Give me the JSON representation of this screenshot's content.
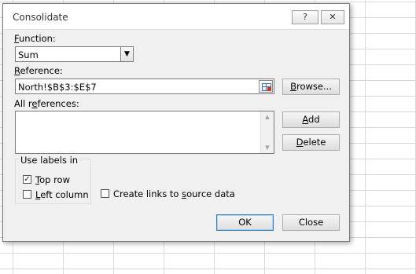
{
  "dialog": {
    "title": "Consolidate",
    "help_button": "?",
    "close_glyph": "✕",
    "help_icon": "question-icon",
    "close_icon": "close-icon"
  },
  "function": {
    "label_accel": "F",
    "label_rest": "unction:",
    "selected_value": "Sum",
    "dropdown_glyph": "▼"
  },
  "reference": {
    "label_accel": "R",
    "label_rest": "eference:",
    "value": "North!$B$3:$E$7",
    "collapse_icon": "collapse-dialog-icon",
    "browse_accel": "B",
    "browse_rest": "rowse..."
  },
  "all_references": {
    "label_accel": "e",
    "label_pre": "All r",
    "label_rest": "ferences:",
    "items": [],
    "scroll_up_glyph": "▲",
    "scroll_down_glyph": "▼",
    "add_accel": "A",
    "add_rest": "dd",
    "delete_accel": "D",
    "delete_rest": "elete"
  },
  "use_labels": {
    "group_title": "Use labels in",
    "top_row": {
      "accel": "T",
      "rest": "op row",
      "checked": true,
      "glyph": "✓"
    },
    "left_column": {
      "accel": "L",
      "rest": "eft column",
      "checked": false
    }
  },
  "create_links": {
    "label_pre": "Create links to ",
    "accel": "s",
    "label_rest": "ource data",
    "checked": false
  },
  "footer": {
    "ok_label": "OK",
    "close_label": "Close"
  }
}
